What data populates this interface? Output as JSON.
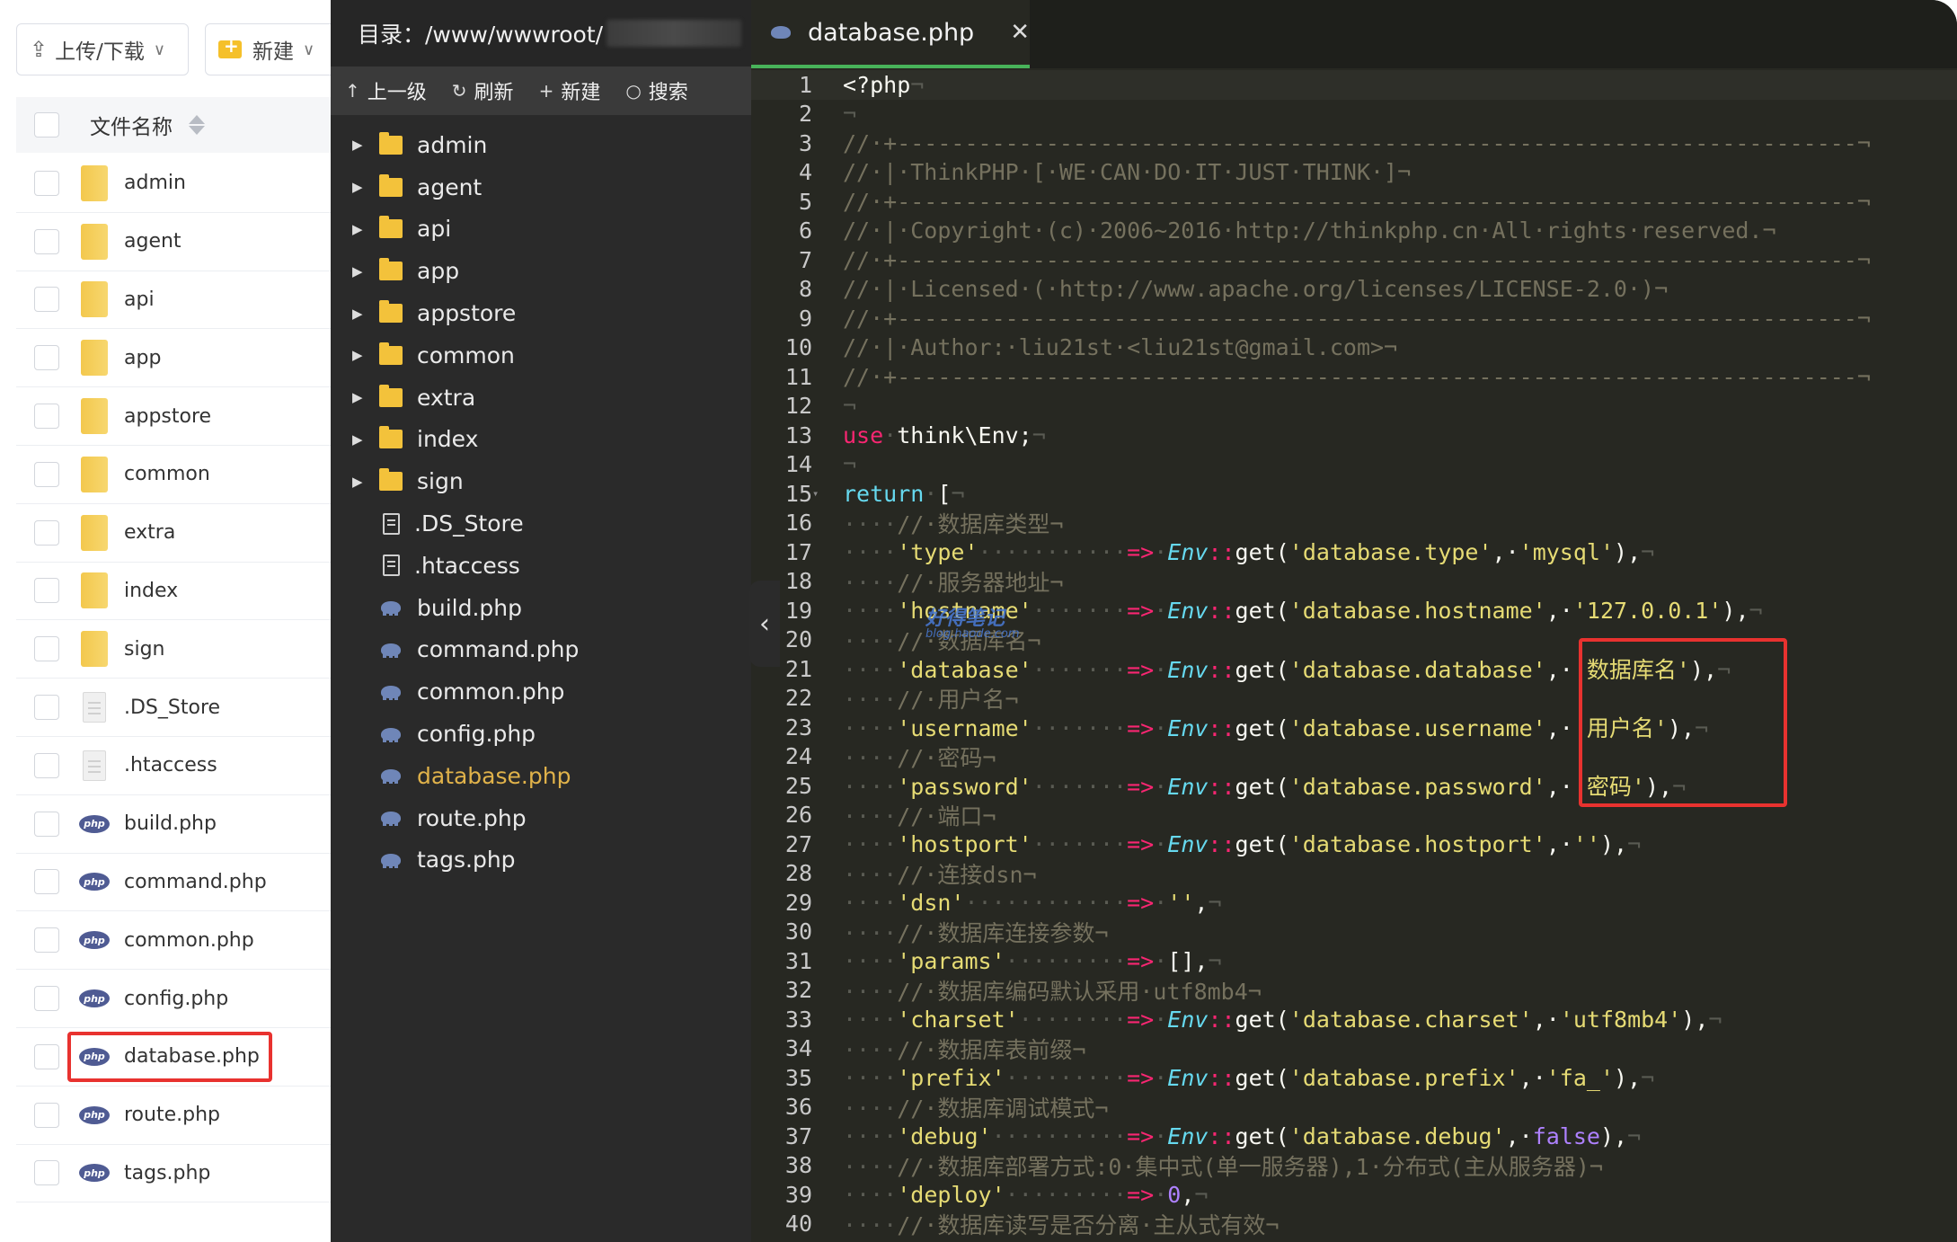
{
  "left_panel": {
    "upload_label": "上传/下载",
    "new_label": "新建",
    "header_label": "文件名称",
    "files": [
      {
        "name": "admin",
        "type": "folder"
      },
      {
        "name": "agent",
        "type": "folder"
      },
      {
        "name": "api",
        "type": "folder"
      },
      {
        "name": "app",
        "type": "folder"
      },
      {
        "name": "appstore",
        "type": "folder"
      },
      {
        "name": "common",
        "type": "folder"
      },
      {
        "name": "extra",
        "type": "folder"
      },
      {
        "name": "index",
        "type": "folder"
      },
      {
        "name": "sign",
        "type": "folder"
      },
      {
        "name": ".DS_Store",
        "type": "doc"
      },
      {
        "name": ".htaccess",
        "type": "doc"
      },
      {
        "name": "build.php",
        "type": "php"
      },
      {
        "name": "command.php",
        "type": "php"
      },
      {
        "name": "common.php",
        "type": "php"
      },
      {
        "name": "config.php",
        "type": "php"
      },
      {
        "name": "database.php",
        "type": "php",
        "highlighted": true
      },
      {
        "name": "route.php",
        "type": "php"
      },
      {
        "name": "tags.php",
        "type": "php"
      }
    ]
  },
  "tree_panel": {
    "title": "目录：/www/wwwroot/",
    "toolbar": {
      "up": "上一级",
      "refresh": "刷新",
      "new": "新建",
      "search": "搜索"
    },
    "items": [
      {
        "name": "admin",
        "type": "folder"
      },
      {
        "name": "agent",
        "type": "folder"
      },
      {
        "name": "api",
        "type": "folder"
      },
      {
        "name": "app",
        "type": "folder"
      },
      {
        "name": "appstore",
        "type": "folder"
      },
      {
        "name": "common",
        "type": "folder"
      },
      {
        "name": "extra",
        "type": "folder"
      },
      {
        "name": "index",
        "type": "folder"
      },
      {
        "name": "sign",
        "type": "folder"
      },
      {
        "name": ".DS_Store",
        "type": "doc"
      },
      {
        "name": ".htaccess",
        "type": "doc"
      },
      {
        "name": "build.php",
        "type": "php"
      },
      {
        "name": "command.php",
        "type": "php"
      },
      {
        "name": "common.php",
        "type": "php"
      },
      {
        "name": "config.php",
        "type": "php"
      },
      {
        "name": "database.php",
        "type": "php",
        "active": true
      },
      {
        "name": "route.php",
        "type": "php"
      },
      {
        "name": "tags.php",
        "type": "php"
      }
    ]
  },
  "editor": {
    "tab_title": "database.php",
    "lines": [
      [
        {
          "t": "<?php",
          "c": "fn"
        },
        {
          "t": "¬",
          "c": "ws"
        }
      ],
      [
        {
          "t": "¬",
          "c": "ws"
        }
      ],
      [
        {
          "t": "//·+-----------------------------------------------------------------------¬",
          "c": "cm"
        }
      ],
      [
        {
          "t": "//·|·ThinkPHP·[·WE·CAN·DO·IT·JUST·THINK·]¬",
          "c": "cm"
        }
      ],
      [
        {
          "t": "//·+-----------------------------------------------------------------------¬",
          "c": "cm"
        }
      ],
      [
        {
          "t": "//·|·Copyright·(c)·2006~2016·http://thinkphp.cn·All·rights·reserved.¬",
          "c": "cm"
        }
      ],
      [
        {
          "t": "//·+-----------------------------------------------------------------------¬",
          "c": "cm"
        }
      ],
      [
        {
          "t": "//·|·Licensed·(·http://www.apache.org/licenses/LICENSE-2.0·)¬",
          "c": "cm"
        }
      ],
      [
        {
          "t": "//·+-----------------------------------------------------------------------¬",
          "c": "cm"
        }
      ],
      [
        {
          "t": "//·|·Author:·liu21st·<liu21st@gmail.com>¬",
          "c": "cm"
        }
      ],
      [
        {
          "t": "//·+-----------------------------------------------------------------------¬",
          "c": "cm"
        }
      ],
      [
        {
          "t": "¬",
          "c": "ws"
        }
      ],
      [
        {
          "t": "use",
          "c": "kw"
        },
        {
          "t": "·",
          "c": "ws"
        },
        {
          "t": "think\\Env;",
          "c": "fn"
        },
        {
          "t": "¬",
          "c": "ws"
        }
      ],
      [
        {
          "t": "¬",
          "c": "ws"
        }
      ],
      [
        {
          "t": "return",
          "c": "kw2"
        },
        {
          "t": "·",
          "c": "ws"
        },
        {
          "t": "[",
          "c": "fn"
        },
        {
          "t": "¬",
          "c": "ws"
        }
      ],
      [
        {
          "t": "····",
          "c": "ws"
        },
        {
          "t": "//·数据库类型¬",
          "c": "cm"
        }
      ],
      [
        {
          "t": "····",
          "c": "ws"
        },
        {
          "t": "'type'",
          "c": "st"
        },
        {
          "t": "···········",
          "c": "ws"
        },
        {
          "t": "=>",
          "c": "op"
        },
        {
          "t": "·",
          "c": "ws"
        },
        {
          "t": "Env",
          "c": "cls"
        },
        {
          "t": "::",
          "c": "op"
        },
        {
          "t": "get(",
          "c": "fn"
        },
        {
          "t": "'database.type'",
          "c": "st"
        },
        {
          "t": ",·",
          "c": "fn"
        },
        {
          "t": "'mysql'",
          "c": "st"
        },
        {
          "t": "),",
          "c": "fn"
        },
        {
          "t": "¬",
          "c": "ws"
        }
      ],
      [
        {
          "t": "····",
          "c": "ws"
        },
        {
          "t": "//·服务器地址¬",
          "c": "cm"
        }
      ],
      [
        {
          "t": "····",
          "c": "ws"
        },
        {
          "t": "'hostname'",
          "c": "st"
        },
        {
          "t": "·······",
          "c": "ws"
        },
        {
          "t": "=>",
          "c": "op"
        },
        {
          "t": "·",
          "c": "ws"
        },
        {
          "t": "Env",
          "c": "cls"
        },
        {
          "t": "::",
          "c": "op"
        },
        {
          "t": "get(",
          "c": "fn"
        },
        {
          "t": "'database.hostname'",
          "c": "st"
        },
        {
          "t": ",·",
          "c": "fn"
        },
        {
          "t": "'127.0.0.1'",
          "c": "st"
        },
        {
          "t": "),",
          "c": "fn"
        },
        {
          "t": "¬",
          "c": "ws"
        }
      ],
      [
        {
          "t": "····",
          "c": "ws"
        },
        {
          "t": "//·数据库名¬",
          "c": "cm"
        }
      ],
      [
        {
          "t": "····",
          "c": "ws"
        },
        {
          "t": "'database'",
          "c": "st"
        },
        {
          "t": "·······",
          "c": "ws"
        },
        {
          "t": "=>",
          "c": "op"
        },
        {
          "t": "·",
          "c": "ws"
        },
        {
          "t": "Env",
          "c": "cls"
        },
        {
          "t": "::",
          "c": "op"
        },
        {
          "t": "get(",
          "c": "fn"
        },
        {
          "t": "'database.database'",
          "c": "st"
        },
        {
          "t": ",·",
          "c": "fn"
        },
        {
          "t": "'数据库名'",
          "c": "st"
        },
        {
          "t": "),",
          "c": "fn"
        },
        {
          "t": "¬",
          "c": "ws"
        }
      ],
      [
        {
          "t": "····",
          "c": "ws"
        },
        {
          "t": "//·用户名¬",
          "c": "cm"
        }
      ],
      [
        {
          "t": "····",
          "c": "ws"
        },
        {
          "t": "'username'",
          "c": "st"
        },
        {
          "t": "·······",
          "c": "ws"
        },
        {
          "t": "=>",
          "c": "op"
        },
        {
          "t": "·",
          "c": "ws"
        },
        {
          "t": "Env",
          "c": "cls"
        },
        {
          "t": "::",
          "c": "op"
        },
        {
          "t": "get(",
          "c": "fn"
        },
        {
          "t": "'database.username'",
          "c": "st"
        },
        {
          "t": ",·",
          "c": "fn"
        },
        {
          "t": "'用户名'",
          "c": "st"
        },
        {
          "t": "),",
          "c": "fn"
        },
        {
          "t": "¬",
          "c": "ws"
        }
      ],
      [
        {
          "t": "····",
          "c": "ws"
        },
        {
          "t": "//·密码¬",
          "c": "cm"
        }
      ],
      [
        {
          "t": "····",
          "c": "ws"
        },
        {
          "t": "'password'",
          "c": "st"
        },
        {
          "t": "·······",
          "c": "ws"
        },
        {
          "t": "=>",
          "c": "op"
        },
        {
          "t": "·",
          "c": "ws"
        },
        {
          "t": "Env",
          "c": "cls"
        },
        {
          "t": "::",
          "c": "op"
        },
        {
          "t": "get(",
          "c": "fn"
        },
        {
          "t": "'database.password'",
          "c": "st"
        },
        {
          "t": ",·",
          "c": "fn"
        },
        {
          "t": "'密码'",
          "c": "st"
        },
        {
          "t": "),",
          "c": "fn"
        },
        {
          "t": "¬",
          "c": "ws"
        }
      ],
      [
        {
          "t": "····",
          "c": "ws"
        },
        {
          "t": "//·端口¬",
          "c": "cm"
        }
      ],
      [
        {
          "t": "····",
          "c": "ws"
        },
        {
          "t": "'hostport'",
          "c": "st"
        },
        {
          "t": "·······",
          "c": "ws"
        },
        {
          "t": "=>",
          "c": "op"
        },
        {
          "t": "·",
          "c": "ws"
        },
        {
          "t": "Env",
          "c": "cls"
        },
        {
          "t": "::",
          "c": "op"
        },
        {
          "t": "get(",
          "c": "fn"
        },
        {
          "t": "'database.hostport'",
          "c": "st"
        },
        {
          "t": ",·",
          "c": "fn"
        },
        {
          "t": "''",
          "c": "st"
        },
        {
          "t": "),",
          "c": "fn"
        },
        {
          "t": "¬",
          "c": "ws"
        }
      ],
      [
        {
          "t": "····",
          "c": "ws"
        },
        {
          "t": "//·连接dsn¬",
          "c": "cm"
        }
      ],
      [
        {
          "t": "····",
          "c": "ws"
        },
        {
          "t": "'dsn'",
          "c": "st"
        },
        {
          "t": "············",
          "c": "ws"
        },
        {
          "t": "=>",
          "c": "op"
        },
        {
          "t": "·",
          "c": "ws"
        },
        {
          "t": "''",
          "c": "st"
        },
        {
          "t": ",",
          "c": "fn"
        },
        {
          "t": "¬",
          "c": "ws"
        }
      ],
      [
        {
          "t": "····",
          "c": "ws"
        },
        {
          "t": "//·数据库连接参数¬",
          "c": "cm"
        }
      ],
      [
        {
          "t": "····",
          "c": "ws"
        },
        {
          "t": "'params'",
          "c": "st"
        },
        {
          "t": "·········",
          "c": "ws"
        },
        {
          "t": "=>",
          "c": "op"
        },
        {
          "t": "·",
          "c": "ws"
        },
        {
          "t": "[],",
          "c": "fn"
        },
        {
          "t": "¬",
          "c": "ws"
        }
      ],
      [
        {
          "t": "····",
          "c": "ws"
        },
        {
          "t": "//·数据库编码默认采用·utf8mb4¬",
          "c": "cm"
        }
      ],
      [
        {
          "t": "····",
          "c": "ws"
        },
        {
          "t": "'charset'",
          "c": "st"
        },
        {
          "t": "········",
          "c": "ws"
        },
        {
          "t": "=>",
          "c": "op"
        },
        {
          "t": "·",
          "c": "ws"
        },
        {
          "t": "Env",
          "c": "cls"
        },
        {
          "t": "::",
          "c": "op"
        },
        {
          "t": "get(",
          "c": "fn"
        },
        {
          "t": "'database.charset'",
          "c": "st"
        },
        {
          "t": ",·",
          "c": "fn"
        },
        {
          "t": "'utf8mb4'",
          "c": "st"
        },
        {
          "t": "),",
          "c": "fn"
        },
        {
          "t": "¬",
          "c": "ws"
        }
      ],
      [
        {
          "t": "····",
          "c": "ws"
        },
        {
          "t": "//·数据库表前缀¬",
          "c": "cm"
        }
      ],
      [
        {
          "t": "····",
          "c": "ws"
        },
        {
          "t": "'prefix'",
          "c": "st"
        },
        {
          "t": "·········",
          "c": "ws"
        },
        {
          "t": "=>",
          "c": "op"
        },
        {
          "t": "·",
          "c": "ws"
        },
        {
          "t": "Env",
          "c": "cls"
        },
        {
          "t": "::",
          "c": "op"
        },
        {
          "t": "get(",
          "c": "fn"
        },
        {
          "t": "'database.prefix'",
          "c": "st"
        },
        {
          "t": ",·",
          "c": "fn"
        },
        {
          "t": "'fa_'",
          "c": "st"
        },
        {
          "t": "),",
          "c": "fn"
        },
        {
          "t": "¬",
          "c": "ws"
        }
      ],
      [
        {
          "t": "····",
          "c": "ws"
        },
        {
          "t": "//·数据库调试模式¬",
          "c": "cm"
        }
      ],
      [
        {
          "t": "····",
          "c": "ws"
        },
        {
          "t": "'debug'",
          "c": "st"
        },
        {
          "t": "··········",
          "c": "ws"
        },
        {
          "t": "=>",
          "c": "op"
        },
        {
          "t": "·",
          "c": "ws"
        },
        {
          "t": "Env",
          "c": "cls"
        },
        {
          "t": "::",
          "c": "op"
        },
        {
          "t": "get(",
          "c": "fn"
        },
        {
          "t": "'database.debug'",
          "c": "st"
        },
        {
          "t": ",·",
          "c": "fn"
        },
        {
          "t": "false",
          "c": "bl"
        },
        {
          "t": "),",
          "c": "fn"
        },
        {
          "t": "¬",
          "c": "ws"
        }
      ],
      [
        {
          "t": "····",
          "c": "ws"
        },
        {
          "t": "//·数据库部署方式:0·集中式(单一服务器),1·分布式(主从服务器)¬",
          "c": "cm"
        }
      ],
      [
        {
          "t": "····",
          "c": "ws"
        },
        {
          "t": "'deploy'",
          "c": "st"
        },
        {
          "t": "·········",
          "c": "ws"
        },
        {
          "t": "=>",
          "c": "op"
        },
        {
          "t": "·",
          "c": "ws"
        },
        {
          "t": "0",
          "c": "bl"
        },
        {
          "t": ",",
          "c": "fn"
        },
        {
          "t": "¬",
          "c": "ws"
        }
      ],
      [
        {
          "t": "····",
          "c": "ws"
        },
        {
          "t": "//·数据库读写是否分离·主从式有效¬",
          "c": "cm"
        }
      ]
    ]
  },
  "watermark": {
    "main": "好得笔记",
    "sub": "blog.haode.com"
  }
}
